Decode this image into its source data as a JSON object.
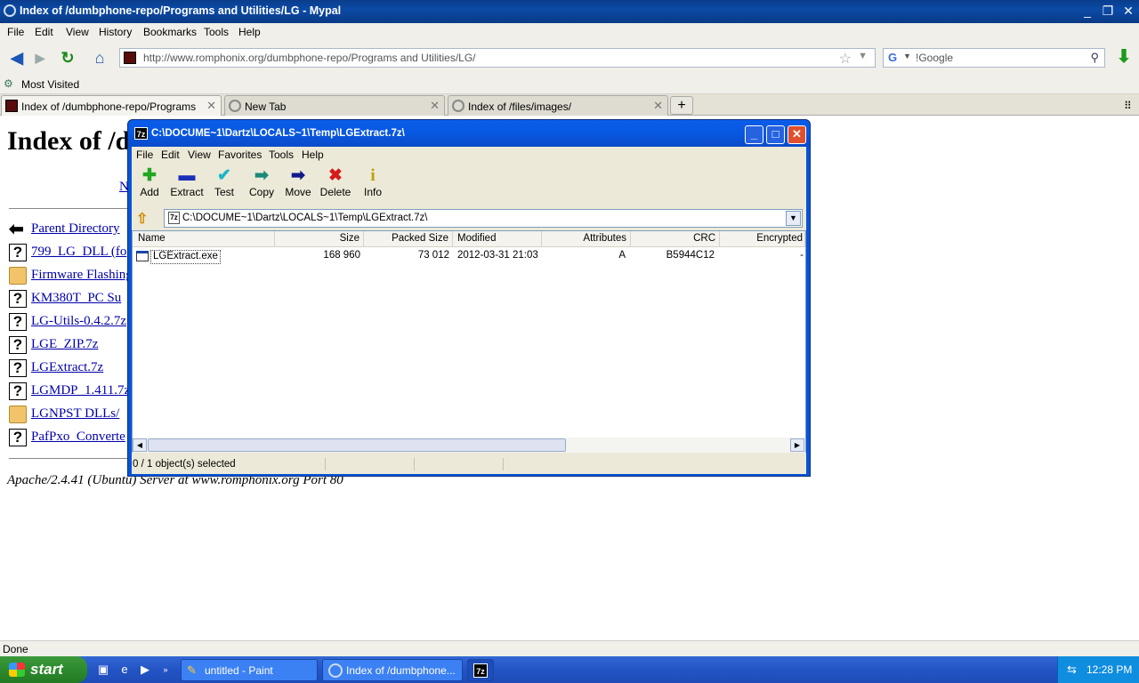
{
  "browser": {
    "title": "Index of /dumbphone-repo/Programs and Utilities/LG - Mypal",
    "menu": [
      "File",
      "Edit",
      "View",
      "History",
      "Bookmarks",
      "Tools",
      "Help"
    ],
    "url": "http://www.romphonix.org/dumbphone-repo/Programs and Utilities/LG/",
    "search_placeholder": "!Google",
    "bookmark": "Most Visited",
    "tabs": [
      {
        "label": "Index of /dumbphone-repo/Programs and ...",
        "active": true
      },
      {
        "label": "New Tab",
        "active": false
      },
      {
        "label": "Index of /files/images/",
        "active": false
      }
    ],
    "status": "Done"
  },
  "page": {
    "heading": "Index of /d",
    "partial_link": "N",
    "entries": [
      {
        "label": "Parent Directory",
        "icon": "back-arrow-icon"
      },
      {
        "label": "799_LG_DLL (fo",
        "icon": "unknown-file-icon"
      },
      {
        "label": "Firmware Flashing",
        "icon": "folder-icon"
      },
      {
        "label": "KM380T_PC Su",
        "icon": "unknown-file-icon"
      },
      {
        "label": "LG-Utils-0.4.2.7z",
        "icon": "unknown-file-icon"
      },
      {
        "label": "LGE_ZIP.7z",
        "icon": "unknown-file-icon"
      },
      {
        "label": "LGExtract.7z",
        "icon": "unknown-file-icon"
      },
      {
        "label": "LGMDP_1.411.7z",
        "icon": "unknown-file-icon"
      },
      {
        "label": "LGNPST DLLs/",
        "icon": "folder-icon"
      },
      {
        "label": "PafPxo_Converte",
        "icon": "unknown-file-icon"
      }
    ],
    "footer": "Apache/2.4.41 (Ubuntu) Server at www.romphonix.org Port 80"
  },
  "zip": {
    "title": "C:\\DOCUME~1\\Dartz\\LOCALS~1\\Temp\\LGExtract.7z\\",
    "menu": [
      "File",
      "Edit",
      "View",
      "Favorites",
      "Tools",
      "Help"
    ],
    "tools": [
      {
        "label": "Add",
        "icon": "add-icon",
        "glyph": "✚",
        "color": "#1fa81f"
      },
      {
        "label": "Extract",
        "icon": "extract-icon",
        "glyph": "▬",
        "color": "#1a2fb8"
      },
      {
        "label": "Test",
        "icon": "test-icon",
        "glyph": "✔",
        "color": "#1db3c9"
      },
      {
        "label": "Copy",
        "icon": "copy-icon",
        "glyph": "➡",
        "color": "#1a8a7a"
      },
      {
        "label": "Move",
        "icon": "move-icon",
        "glyph": "➡",
        "color": "#111a8a"
      },
      {
        "label": "Delete",
        "icon": "delete-icon",
        "glyph": "✖",
        "color": "#d41a1a"
      },
      {
        "label": "Info",
        "icon": "info-icon",
        "glyph": "i",
        "color": "#b8a000"
      }
    ],
    "address": "C:\\DOCUME~1\\Dartz\\LOCALS~1\\Temp\\LGExtract.7z\\",
    "columns": [
      "Name",
      "Size",
      "Packed Size",
      "Modified",
      "Attributes",
      "CRC",
      "Encrypted"
    ],
    "rows": [
      {
        "name": "LGExtract.exe",
        "size": "168 960",
        "packed": "73 012",
        "modified": "2012-03-31 21:03",
        "attributes": "A",
        "crc": "B5944C12",
        "encrypted": "-"
      }
    ],
    "status": "0 / 1 object(s) selected"
  },
  "taskbar": {
    "start": "start",
    "tasks": [
      "untitled - Paint",
      "Index of /dumbphone...",
      "7z"
    ],
    "clock": "12:28 PM"
  }
}
